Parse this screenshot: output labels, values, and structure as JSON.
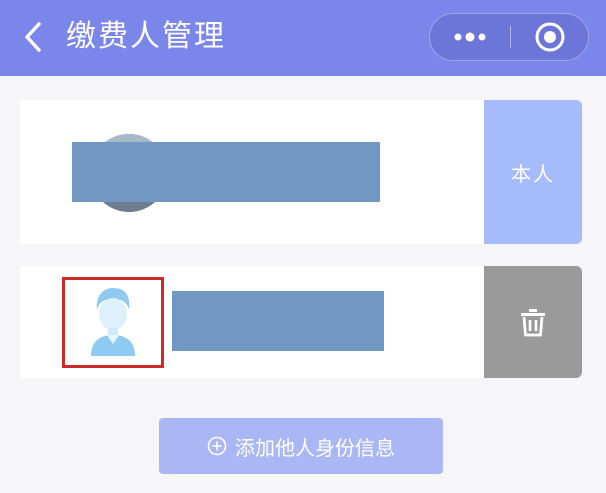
{
  "header": {
    "title": "缴费人管理",
    "back_icon": "chevron-left-icon",
    "more_icon": "more-dots-icon",
    "close_icon": "target-circle-icon"
  },
  "payers": [
    {
      "type": "self",
      "avatar": "photo-avatar",
      "name_redacted": true,
      "action_label": "本人"
    },
    {
      "type": "other",
      "avatar": "default-user-avatar",
      "avatar_highlighted": true,
      "name_redacted": true,
      "action_icon": "trash-icon"
    }
  ],
  "add_button": {
    "label": "添加他人身份信息",
    "icon": "plus-circle-icon"
  },
  "colors": {
    "header": "#7b86ea",
    "self_button": "#a6bcfa",
    "delete_button": "#9a9a9a",
    "add_button": "#a9b7f5",
    "highlight_border": "#cd2b2b",
    "redaction": "#7197c3"
  }
}
